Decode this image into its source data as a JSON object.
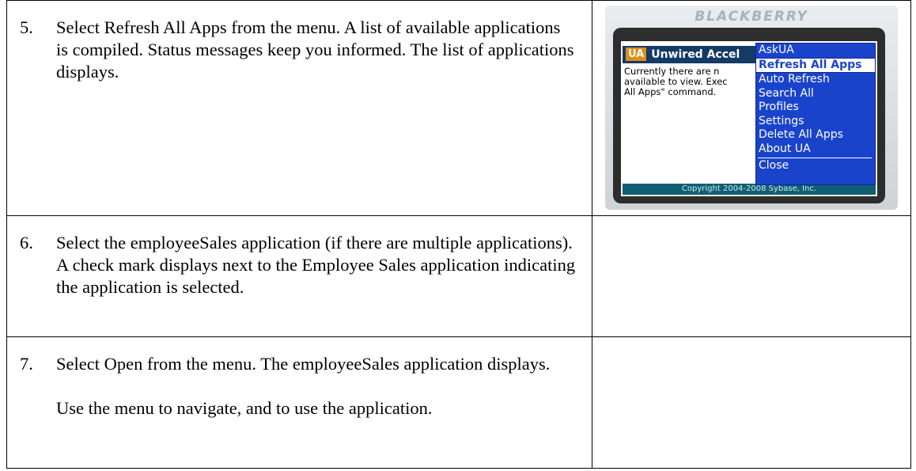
{
  "steps": [
    {
      "number": "5.",
      "text": "Select Refresh All Apps from the menu. A list of available applications is compiled. Status messages keep you informed. The list of applications displays."
    },
    {
      "number": "6.",
      "text": "Select the employeeSales application (if there are multiple applications). A check mark displays next to the Employee Sales application indicating the application is selected."
    },
    {
      "number": "7.",
      "text": "Select Open from the menu. The employeeSales application displays.",
      "extra_text": "Use the menu to navigate, and to use the application."
    }
  ],
  "device": {
    "brand": "BLACKBERRY",
    "app_logo": "UA",
    "app_title": "Unwired Accel",
    "body_lines": [
      "Currently there are n",
      "available to view. Exec",
      "All Apps\" command."
    ],
    "footer": "Copyright 2004-2008 Sybase, Inc.",
    "menu_items": [
      "AskUA",
      "Refresh All Apps",
      "Auto Refresh",
      "Search All",
      "Profiles",
      "Settings",
      "Delete All Apps",
      "About UA"
    ],
    "menu_close": "Close",
    "selected_item": "Refresh All Apps"
  }
}
